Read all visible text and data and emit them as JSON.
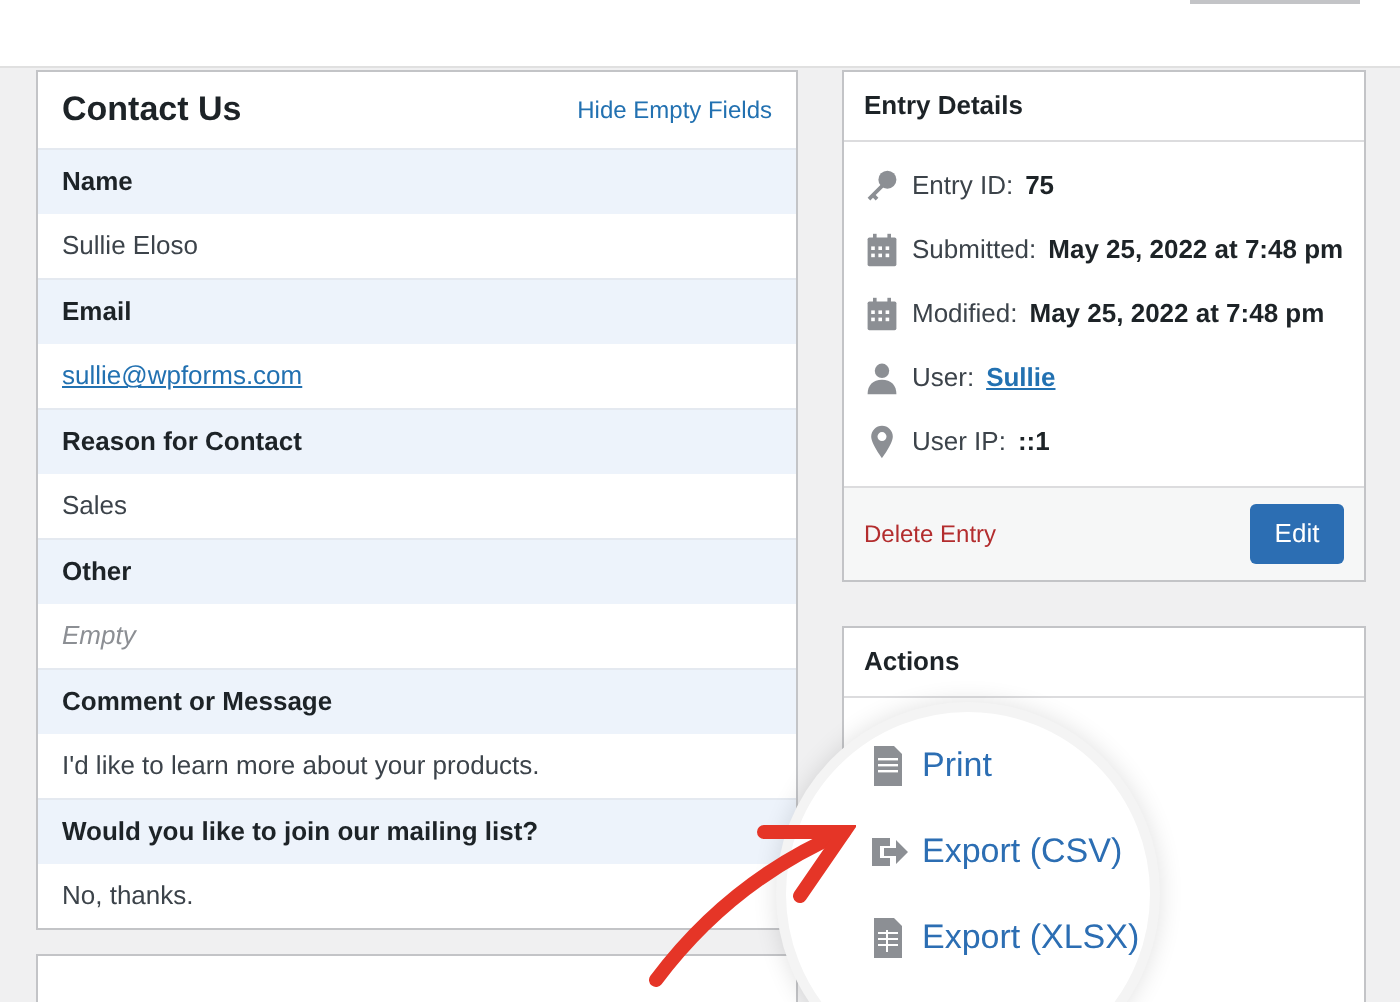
{
  "entry": {
    "title": "Contact Us",
    "hide_link": "Hide Empty Fields",
    "fields": [
      {
        "label": "Name",
        "value": "Sullie Eloso",
        "kind": "text"
      },
      {
        "label": "Email",
        "value": "sullie@wpforms.com",
        "kind": "link"
      },
      {
        "label": "Reason for Contact",
        "value": "Sales",
        "kind": "text"
      },
      {
        "label": "Other",
        "value": "Empty",
        "kind": "empty"
      },
      {
        "label": "Comment or Message",
        "value": "I'd like to learn more about your products.",
        "kind": "text"
      },
      {
        "label": "Would you like to join our mailing list?",
        "value": "No, thanks.",
        "kind": "text"
      }
    ]
  },
  "details": {
    "title": "Entry Details",
    "items": [
      {
        "label": "Entry ID:",
        "value": "75",
        "kind": "bold"
      },
      {
        "label": "Submitted:",
        "value": "May 25, 2022 at 7:48 pm",
        "kind": "bold"
      },
      {
        "label": "Modified:",
        "value": "May 25, 2022 at 7:48 pm",
        "kind": "bold"
      },
      {
        "label": "User:",
        "value": "Sullie",
        "kind": "link"
      },
      {
        "label": "User IP:",
        "value": "::1",
        "kind": "bold"
      }
    ],
    "delete": "Delete Entry",
    "edit": "Edit"
  },
  "actions": {
    "title": "Actions",
    "items": [
      {
        "label": "Print"
      },
      {
        "label": "Export (CSV)"
      },
      {
        "label": "Export (XLSX)"
      }
    ]
  }
}
